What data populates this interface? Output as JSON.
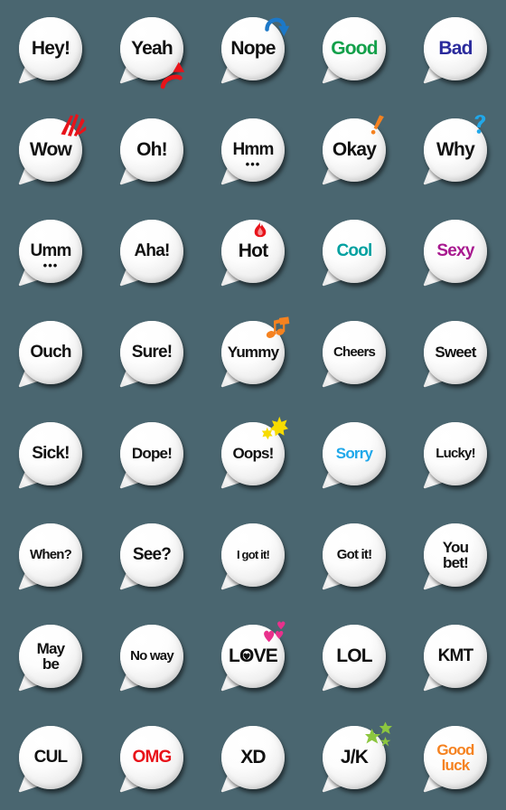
{
  "background_color": "#4a6670",
  "grid": {
    "columns": 5,
    "rows": 8,
    "cell_size_px": 112
  },
  "palette": {
    "default_text": "#111111",
    "green": "#12a04a",
    "navy": "#2a2a9c",
    "teal": "#00a0a0",
    "magenta": "#a8198f",
    "sky_blue": "#20a8ea",
    "red": "#e8131a",
    "orange": "#f58220",
    "yellow": "#f5d800",
    "pink": "#e8318c",
    "green_star": "#8cc63f",
    "arrow_blue": "#1c78c8"
  },
  "stickers": [
    {
      "id": "hey",
      "text": "Hey!",
      "color": "#111111",
      "size": "sz-xl",
      "decoration": "none"
    },
    {
      "id": "yeah",
      "text": "Yeah",
      "color": "#111111",
      "size": "sz-xl",
      "decoration": "red-arrow-up"
    },
    {
      "id": "nope",
      "text": "Nope",
      "color": "#111111",
      "size": "sz-xl",
      "decoration": "blue-curved-arrow"
    },
    {
      "id": "good",
      "text": "Good",
      "color": "#12a04a",
      "size": "sz-xl",
      "decoration": "none"
    },
    {
      "id": "bad",
      "text": "Bad",
      "color": "#2a2a9c",
      "size": "sz-xl",
      "decoration": "none"
    },
    {
      "id": "wow",
      "text": "Wow",
      "color": "#111111",
      "size": "sz-xl",
      "decoration": "red-burst"
    },
    {
      "id": "oh",
      "text": "Oh!",
      "color": "#111111",
      "size": "sz-xl",
      "decoration": "none"
    },
    {
      "id": "hmm",
      "text": "Hmm",
      "color": "#111111",
      "size": "sz-lg",
      "decoration": "dots"
    },
    {
      "id": "okay",
      "text": "Okay",
      "color": "#111111",
      "size": "sz-xl",
      "decoration": "orange-exclamation"
    },
    {
      "id": "why",
      "text": "Why",
      "color": "#111111",
      "size": "sz-xl",
      "decoration": "blue-question"
    },
    {
      "id": "umm",
      "text": "Umm",
      "color": "#111111",
      "size": "sz-lg",
      "decoration": "dots"
    },
    {
      "id": "aha",
      "text": "Aha!",
      "color": "#111111",
      "size": "sz-lg",
      "decoration": "none"
    },
    {
      "id": "hot",
      "text": "Hot",
      "color": "#111111",
      "size": "sz-xl",
      "decoration": "flame"
    },
    {
      "id": "cool",
      "text": "Cool",
      "color": "#00a0a0",
      "size": "sz-lg",
      "decoration": "none"
    },
    {
      "id": "sexy",
      "text": "Sexy",
      "color": "#a8198f",
      "size": "sz-lg",
      "decoration": "none"
    },
    {
      "id": "ouch",
      "text": "Ouch",
      "color": "#111111",
      "size": "sz-lg",
      "decoration": "none"
    },
    {
      "id": "sure",
      "text": "Sure!",
      "color": "#111111",
      "size": "sz-lg",
      "decoration": "none"
    },
    {
      "id": "yummy",
      "text": "Yummy",
      "color": "#111111",
      "size": "sz-md",
      "decoration": "music-notes"
    },
    {
      "id": "cheers",
      "text": "Cheers",
      "color": "#111111",
      "size": "sz-sm",
      "decoration": "none"
    },
    {
      "id": "sweet",
      "text": "Sweet",
      "color": "#111111",
      "size": "sz-md",
      "decoration": "none"
    },
    {
      "id": "sick",
      "text": "Sick!",
      "color": "#111111",
      "size": "sz-lg",
      "decoration": "none"
    },
    {
      "id": "dope",
      "text": "Dope!",
      "color": "#111111",
      "size": "sz-md",
      "decoration": "none"
    },
    {
      "id": "oops",
      "text": "Oops!",
      "color": "#111111",
      "size": "sz-md",
      "decoration": "yellow-starbursts"
    },
    {
      "id": "sorry",
      "text": "Sorry",
      "color": "#20a8ea",
      "size": "sz-md",
      "decoration": "none"
    },
    {
      "id": "lucky",
      "text": "Lucky!",
      "color": "#111111",
      "size": "sz-sm",
      "decoration": "none"
    },
    {
      "id": "when",
      "text": "When?",
      "color": "#111111",
      "size": "sz-sm",
      "decoration": "none"
    },
    {
      "id": "see",
      "text": "See?",
      "color": "#111111",
      "size": "sz-lg",
      "decoration": "none"
    },
    {
      "id": "igotit",
      "text": "I got it!",
      "color": "#111111",
      "size": "sz-tiny",
      "decoration": "none"
    },
    {
      "id": "gotit",
      "text": "Got it!",
      "color": "#111111",
      "size": "sz-sm",
      "decoration": "none"
    },
    {
      "id": "youbet",
      "lines": [
        "You",
        "bet!"
      ],
      "color": "#111111",
      "size": "sz-md",
      "decoration": "none"
    },
    {
      "id": "maybe",
      "lines": [
        "May",
        "be"
      ],
      "color": "#111111",
      "size": "sz-md",
      "decoration": "none"
    },
    {
      "id": "noway",
      "text": "No way",
      "color": "#111111",
      "size": "sz-sm",
      "decoration": "none"
    },
    {
      "id": "love",
      "text": "LOVE",
      "color": "#111111",
      "size": "sz-xl",
      "decoration": "pink-hearts"
    },
    {
      "id": "lol",
      "text": "LOL",
      "color": "#111111",
      "size": "sz-xl",
      "decoration": "none"
    },
    {
      "id": "kmt",
      "text": "KMT",
      "color": "#111111",
      "size": "sz-lg",
      "decoration": "none"
    },
    {
      "id": "cul",
      "text": "CUL",
      "color": "#111111",
      "size": "sz-lg",
      "decoration": "none"
    },
    {
      "id": "omg",
      "text": "OMG",
      "color": "#e8131a",
      "size": "sz-lg",
      "decoration": "none"
    },
    {
      "id": "xd",
      "text": "XD",
      "color": "#111111",
      "size": "sz-xl",
      "decoration": "none"
    },
    {
      "id": "jk",
      "text": "J/K",
      "color": "#111111",
      "size": "sz-xl",
      "decoration": "green-stars"
    },
    {
      "id": "goodluck",
      "lines": [
        "Good",
        "luck"
      ],
      "color": "#f58220",
      "size": "sz-md",
      "decoration": "none"
    }
  ]
}
